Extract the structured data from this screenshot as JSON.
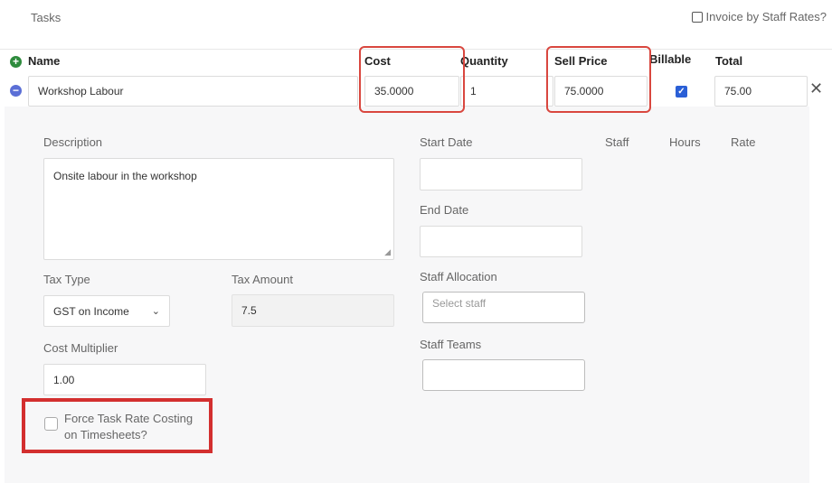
{
  "section": {
    "title": "Tasks",
    "invoice_by_staff_rates": "Invoice by Staff Rates?"
  },
  "columns": {
    "name": "Name",
    "cost": "Cost",
    "quantity": "Quantity",
    "sell_price": "Sell Price",
    "billable": "Billable",
    "total": "Total"
  },
  "task": {
    "name": "Workshop Labour",
    "cost": "35.0000",
    "quantity": "1",
    "sell_price": "75.0000",
    "billable": true,
    "total": "75.00"
  },
  "details": {
    "description_label": "Description",
    "description": "Onsite labour in the workshop",
    "tax_type_label": "Tax Type",
    "tax_type": "GST on Income",
    "tax_amount_label": "Tax Amount",
    "tax_amount": "7.5",
    "cost_multiplier_label": "Cost Multiplier",
    "cost_multiplier": "1.00",
    "force_task_rate_line1": "Force Task Rate Costing",
    "force_task_rate_line2": "on Timesheets?",
    "start_date_label": "Start Date",
    "end_date_label": "End Date",
    "staff_allocation_label": "Staff Allocation",
    "staff_allocation_placeholder": "Select staff",
    "staff_teams_label": "Staff Teams",
    "staff_col": "Staff",
    "hours_col": "Hours",
    "rate_col": "Rate"
  },
  "colors": {
    "highlight_border": "#d9473f",
    "highlight_square": "#d32f2f",
    "add_icon": "#2e8b3d",
    "collapse_icon": "#5b6fd6",
    "checkbox": "#2a5fd6"
  }
}
